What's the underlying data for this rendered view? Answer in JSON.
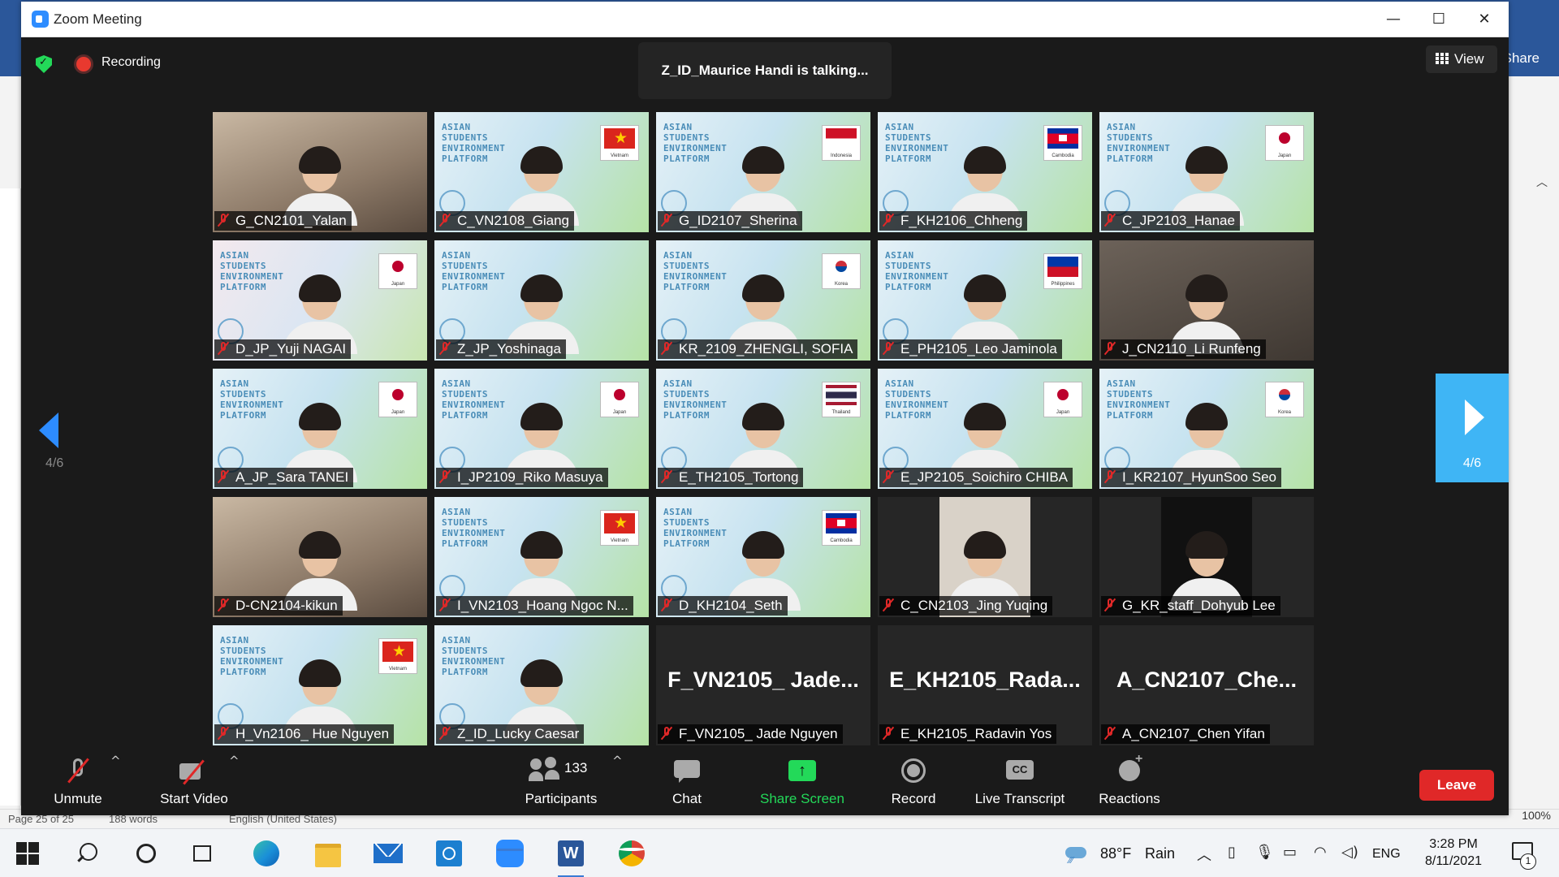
{
  "window": {
    "title": "Zoom Meeting"
  },
  "background_app": {
    "share_label": "Share",
    "status": {
      "page": "Page 25 of 25",
      "words": "188 words",
      "language": "English (United States)",
      "zoom": "100%"
    }
  },
  "meeting": {
    "recording_label": "Recording",
    "talking": "Z_ID_Maurice Handi is talking...",
    "view_label": "View",
    "page_indicator": "4/6",
    "tiles": [
      {
        "name": "G_CN2101_Yalan",
        "style": "home",
        "flag": ""
      },
      {
        "name": "C_VN2108_Giang",
        "style": "aesp",
        "flag": "vn",
        "flag_label": "Vietnam"
      },
      {
        "name": "G_ID2107_Sherina",
        "style": "aesp",
        "flag": "id",
        "flag_label": "Indonesia"
      },
      {
        "name": "F_KH2106_Chheng",
        "style": "aesp",
        "flag": "kh",
        "flag_label": "Cambodia"
      },
      {
        "name": "C_JP2103_Hanae",
        "style": "aesp",
        "flag": "jp",
        "flag_label": "Japan"
      },
      {
        "name": "D_JP_Yuji NAGAI",
        "style": "aesp alt",
        "flag": "jp",
        "flag_label": "Japan"
      },
      {
        "name": "Z_JP_Yoshinaga",
        "style": "aesp",
        "flag": ""
      },
      {
        "name": "KR_2109_ZHENGLI, SOFIA",
        "style": "aesp",
        "flag": "kr",
        "flag_label": "Korea"
      },
      {
        "name": "E_PH2105_Leo Jaminola",
        "style": "aesp",
        "flag": "ph",
        "flag_label": "Philippines"
      },
      {
        "name": "J_CN2110_Li Runfeng",
        "style": "home2",
        "flag": ""
      },
      {
        "name": "A_JP_Sara TANEI",
        "style": "aesp",
        "flag": "jp",
        "flag_label": "Japan"
      },
      {
        "name": "I_JP2109_Riko Masuya",
        "style": "aesp",
        "flag": "jp",
        "flag_label": "Japan"
      },
      {
        "name": "E_TH2105_Tortong",
        "style": "aesp",
        "flag": "th",
        "flag_label": "Thailand"
      },
      {
        "name": "E_JP2105_Soichiro CHIBA",
        "style": "aesp",
        "flag": "jp",
        "flag_label": "Japan"
      },
      {
        "name": "I_KR2107_HyunSoo Seo",
        "style": "aesp",
        "flag": "kr",
        "flag_label": "Korea"
      },
      {
        "name": "D-CN2104-kikun",
        "style": "home",
        "flag": ""
      },
      {
        "name": "I_VN2103_Hoang Ngoc N...",
        "style": "aesp",
        "flag": "vn",
        "flag_label": "Vietnam"
      },
      {
        "name": "D_KH2104_Seth",
        "style": "aesp",
        "flag": "kh",
        "flag_label": "Cambodia"
      },
      {
        "name": "C_CN2103_Jing Yuqing",
        "style": "dark",
        "cam": "light",
        "flag": ""
      },
      {
        "name": "G_KR_staff_Dohyub Lee",
        "style": "dark",
        "cam": "black",
        "flag": ""
      },
      {
        "name": "H_Vn2106_ Hue Nguyen",
        "style": "aesp",
        "flag": "vn",
        "flag_label": "Vietnam"
      },
      {
        "name": "Z_ID_Lucky Caesar",
        "style": "aesp",
        "flag": ""
      },
      {
        "name": "F_VN2105_ Jade Nguyen",
        "style": "dark",
        "big_name": "F_VN2105_ Jade...",
        "flag": ""
      },
      {
        "name": "E_KH2105_Radavin Yos",
        "style": "dark",
        "big_name": "E_KH2105_Rada...",
        "flag": ""
      },
      {
        "name": "A_CN2107_Chen Yifan",
        "style": "dark",
        "big_name": "A_CN2107_Che...",
        "flag": ""
      }
    ]
  },
  "toolbar": {
    "unmute": "Unmute",
    "start_video": "Start Video",
    "participants": "Participants",
    "participants_count": "133",
    "chat": "Chat",
    "share_screen": "Share Screen",
    "record": "Record",
    "live_transcript": "Live Transcript",
    "reactions": "Reactions",
    "leave": "Leave"
  },
  "taskbar": {
    "weather_temp": "88°F",
    "weather_cond": "Rain",
    "language": "ENG",
    "time": "3:28 PM",
    "date": "8/11/2021",
    "notification_count": "1"
  },
  "colors": {
    "zoom_blue": "#2d8cff",
    "leave_red": "#e02828",
    "share_green": "#23d959",
    "meeting_bg": "#1a1a1a"
  }
}
